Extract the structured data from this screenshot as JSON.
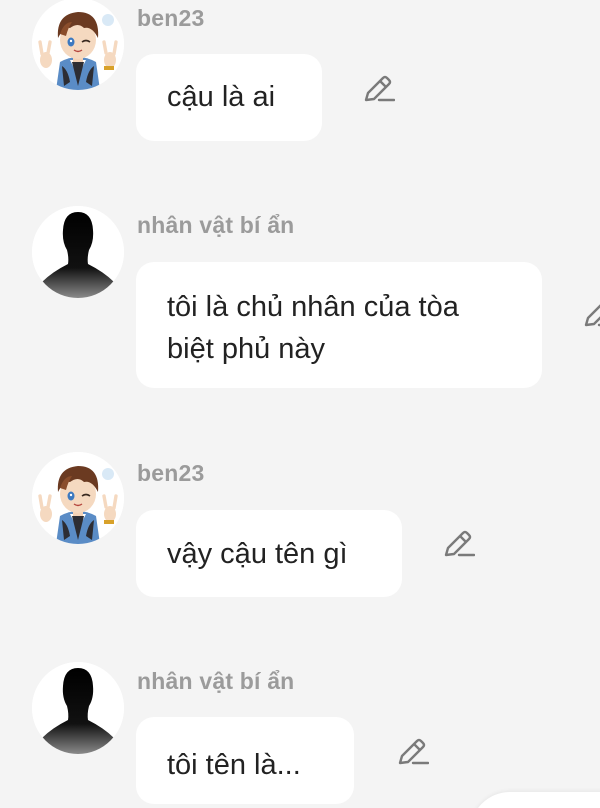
{
  "messages": [
    {
      "user": "ben23",
      "avatar": "boy-character-avatar",
      "text": "cậu là ai",
      "icon": "pencil-icon"
    },
    {
      "user": "nhân vật bí ẩn",
      "avatar": "silhouette-avatar",
      "text": "tôi là chủ nhân của tòa biệt phủ này",
      "icon": "pencil-icon"
    },
    {
      "user": "ben23",
      "avatar": "boy-character-avatar",
      "text": "vậy cậu tên gì",
      "icon": "pencil-icon"
    },
    {
      "user": "nhân vật bí ẩn",
      "avatar": "silhouette-avatar",
      "text": "tôi tên là...",
      "icon": "pencil-icon"
    }
  ],
  "colors": {
    "background": "#f4f4f4",
    "bubble": "#ffffff",
    "username": "#9b9b9b",
    "text": "#222222",
    "icon": "#7a7a7a"
  }
}
